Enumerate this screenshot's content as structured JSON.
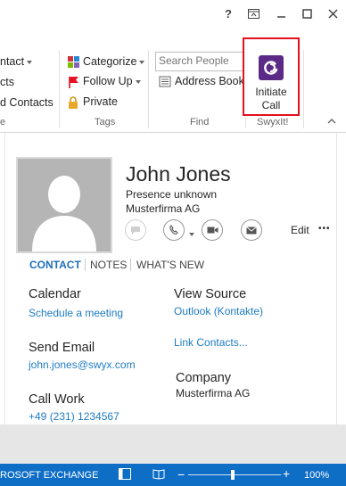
{
  "titlebar": {
    "help_label": "?"
  },
  "ribbon": {
    "contact_label": "ntact",
    "cts_label": "cts",
    "d_contacts_label": "d Contacts",
    "e_label": "e",
    "categorize_label": "Categorize",
    "follow_up_label": "Follow Up",
    "private_label": "Private",
    "tags_group_label": "Tags",
    "search_people_placeholder": "Search People",
    "address_book_label": "Address Book",
    "find_group_label": "Find",
    "initiate_call_label_line1": "Initiate",
    "initiate_call_label_line2": "Call",
    "swyxit_group_label": "SwyxIt!",
    "highlight_color": "#e3101e",
    "swyx_brand_color": "#5b2a86"
  },
  "contact": {
    "name": "John Jones",
    "presence": "Presence unknown",
    "company_line": "Musterfirma AG",
    "edit_label": "Edit",
    "more_label": "•••"
  },
  "tabs": [
    {
      "label": "CONTACT",
      "active": true
    },
    {
      "label": "NOTES",
      "active": false
    },
    {
      "label": "WHAT'S NEW",
      "active": false
    }
  ],
  "details": {
    "calendar_header": "Calendar",
    "schedule_link": "Schedule a meeting",
    "send_email_header": "Send Email",
    "email": "john.jones@swyx.com",
    "call_work_header": "Call Work",
    "phone": "+49 (231) 1234567",
    "view_source_header": "View Source",
    "source_link": "Outlook (Kontakte)",
    "link_contacts": "Link Contacts...",
    "company_header": "Company",
    "company_value": "Musterfirma AG"
  },
  "statusbar": {
    "exchange_label": "ROSOFT EXCHANGE",
    "zoom": "100%",
    "background_color": "#0e6ec6"
  }
}
